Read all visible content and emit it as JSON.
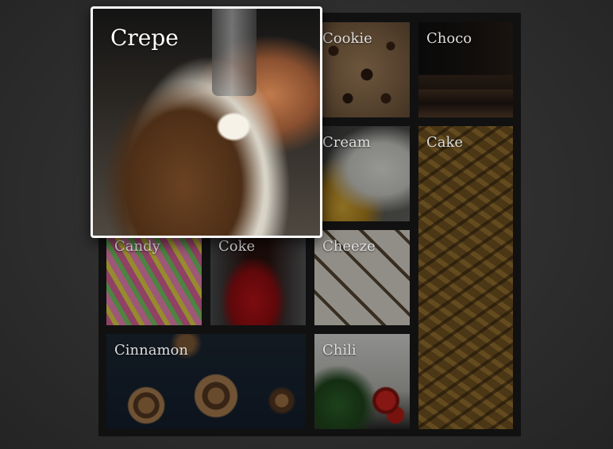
{
  "gallery": {
    "highlighted": {
      "label": "Crepe"
    },
    "tiles": [
      {
        "label": "Cookie"
      },
      {
        "label": "Choco"
      },
      {
        "label": "Cream"
      },
      {
        "label": "Cake"
      },
      {
        "label": "Candy"
      },
      {
        "label": "Coke"
      },
      {
        "label": "Cheeze"
      },
      {
        "label": "Cinnamon"
      },
      {
        "label": "Chili"
      }
    ]
  }
}
